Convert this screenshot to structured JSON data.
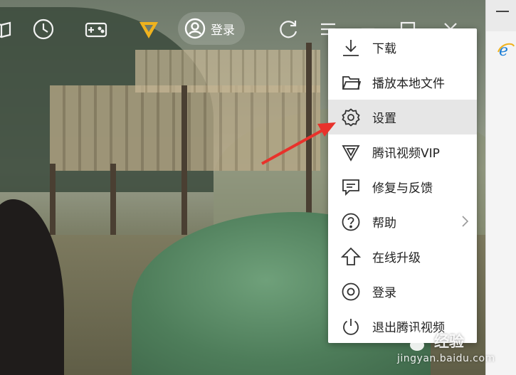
{
  "toolbar": {
    "login_label": "登录",
    "icons": [
      "book-icon",
      "history-icon",
      "game-icon",
      "vip-logo-icon",
      "user-icon",
      "refresh-icon",
      "menu-icon",
      "minimize-icon",
      "maximize-icon",
      "close-icon"
    ]
  },
  "menu": {
    "items": [
      {
        "label": "下载",
        "icon": "download-icon"
      },
      {
        "label": "播放本地文件",
        "icon": "folder-icon"
      },
      {
        "label": "设置",
        "icon": "gear-icon",
        "highlighted": true
      },
      {
        "label": "腾讯视频VIP",
        "icon": "vip-icon"
      },
      {
        "label": "修复与反馈",
        "icon": "feedback-icon"
      },
      {
        "label": "帮助",
        "icon": "help-icon",
        "has_submenu": true
      },
      {
        "label": "在线升级",
        "icon": "upgrade-icon"
      },
      {
        "label": "登录",
        "icon": "login-icon"
      },
      {
        "label": "退出腾讯视频",
        "icon": "power-icon"
      }
    ]
  },
  "watermark": {
    "top": "经验",
    "bottom": "jingyan.baidu.com"
  },
  "colors": {
    "menu_bg": "#ffffff",
    "menu_hover": "#e6e6e6",
    "arrow": "#e8322b",
    "vip_gold": "#f0b21e"
  }
}
